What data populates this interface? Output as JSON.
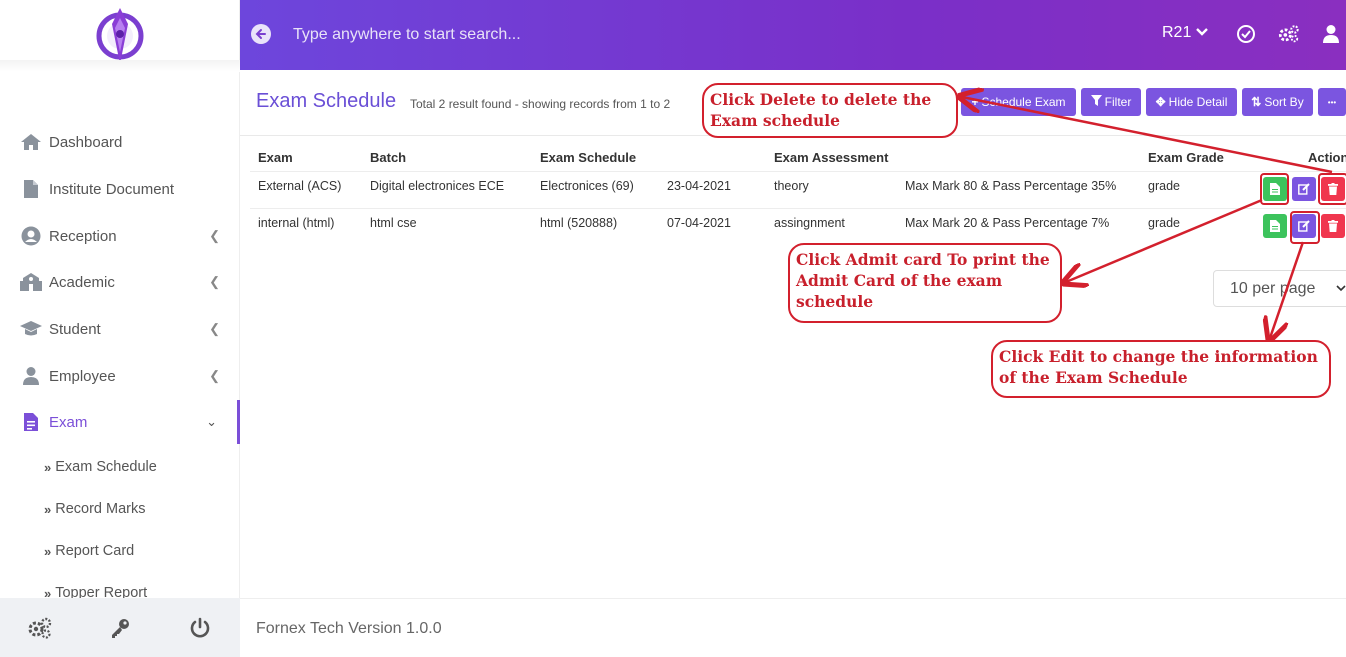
{
  "search": {
    "placeholder": "Type anywhere to start search..."
  },
  "header": {
    "session": "R21"
  },
  "sidebar": {
    "items": [
      {
        "label": "Dashboard",
        "icon": "home-icon"
      },
      {
        "label": "Institute Document",
        "icon": "document-icon"
      },
      {
        "label": "Reception",
        "icon": "user-circle-icon"
      },
      {
        "label": "Academic",
        "icon": "school-icon"
      },
      {
        "label": "Student",
        "icon": "graduation-cap-icon"
      },
      {
        "label": "Employee",
        "icon": "employee-icon"
      },
      {
        "label": "Exam",
        "icon": "exam-file-icon"
      }
    ],
    "subitems": [
      {
        "label": "Exam Schedule"
      },
      {
        "label": "Record Marks"
      },
      {
        "label": "Report Card"
      },
      {
        "label": "Topper Report"
      }
    ]
  },
  "page": {
    "title": "Exam Schedule",
    "subtitle": "Total 2 result found - showing records from 1 to 2"
  },
  "toolbar": {
    "schedule_exam": "Schedule Exam",
    "filter": "Filter",
    "hide_detail": "Hide Detail",
    "sort_by": "Sort By",
    "more": "•••"
  },
  "table": {
    "headers": {
      "exam": "Exam",
      "batch": "Batch",
      "exam_schedule": "Exam Schedule",
      "exam_assessment": "Exam Assessment",
      "exam_grade": "Exam Grade",
      "action": "Action"
    },
    "rows": [
      {
        "exam": "External (ACS)",
        "batch": "Digital electronices ECE",
        "schedule": "Electronices (69)",
        "date": "23-04-2021",
        "assessment": "theory",
        "marks": "Max Mark 80 & Pass Percentage 35%",
        "grade": "grade"
      },
      {
        "exam": "internal (html)",
        "batch": "html cse",
        "schedule": "html (520888)",
        "date": "07-04-2021",
        "assessment": "assingnment",
        "marks": "Max Mark 20 & Pass Percentage 7%",
        "grade": "grade"
      }
    ]
  },
  "pagination": {
    "per_page": "10 per page"
  },
  "footer": {
    "version": "Fornex Tech Version 1.0.0"
  },
  "annotations": {
    "delete": "Click Delete to delete the Exam schedule",
    "admit": "Click Admit card To print the Admit Card of the exam schedule",
    "edit": "Click Edit to change the information of the Exam Schedule"
  },
  "colors": {
    "accent": "#7b55e0",
    "header_gradient_start": "#6d46dc",
    "header_gradient_end": "#8a2fc0",
    "action_green": "#3cc35c",
    "action_red": "#f0364e",
    "annotation_red": "#d3202d"
  }
}
